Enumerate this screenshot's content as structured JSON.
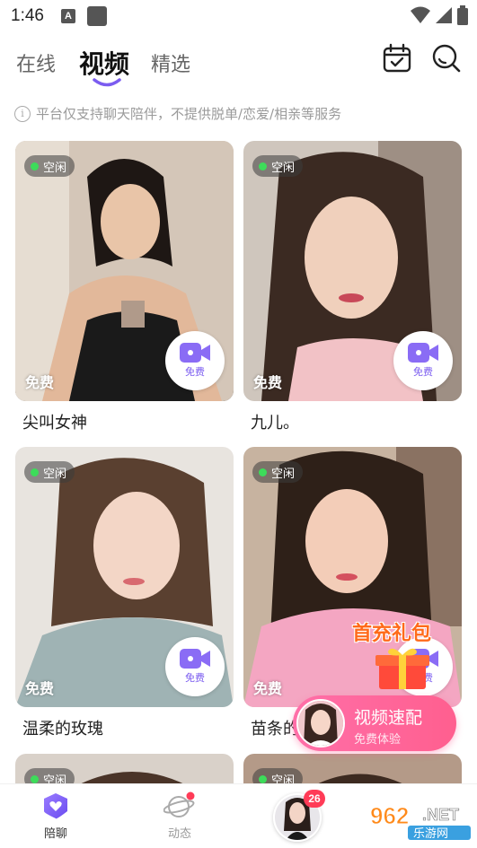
{
  "status_bar": {
    "time": "1:46",
    "a_icon": "A"
  },
  "tabs": [
    {
      "label": "在线"
    },
    {
      "label": "视频"
    },
    {
      "label": "精选"
    }
  ],
  "notice": "平台仅支持聊天陪伴，不提供脱单/恋爱/相亲等服务",
  "cards": [
    {
      "status": "空闲",
      "free": "免费",
      "btn": "免费",
      "name": "尖叫女神"
    },
    {
      "status": "空闲",
      "free": "免费",
      "btn": "免费",
      "name": "九儿。"
    },
    {
      "status": "空闲",
      "free": "免费",
      "btn": "免费",
      "name": "温柔的玫瑰"
    },
    {
      "status": "空闲",
      "free": "免费",
      "btn": "免费",
      "name": "苗条的"
    },
    {
      "status": "空闲"
    },
    {
      "status": "空闲"
    }
  ],
  "promo": {
    "gift_text": "首充礼包",
    "match_title": "视频速配",
    "match_sub": "免费体验"
  },
  "bottom_nav": {
    "chat": "陪聊",
    "feed": "动态",
    "badge": "26"
  },
  "watermark": {
    "line1": "962",
    "line2": ".NET",
    "line3": "乐游网"
  },
  "colors": {
    "accent": "#7b5cf0",
    "online": "#3ddc5a",
    "pink": "#ff5f8f",
    "badge": "#ff3b57"
  }
}
